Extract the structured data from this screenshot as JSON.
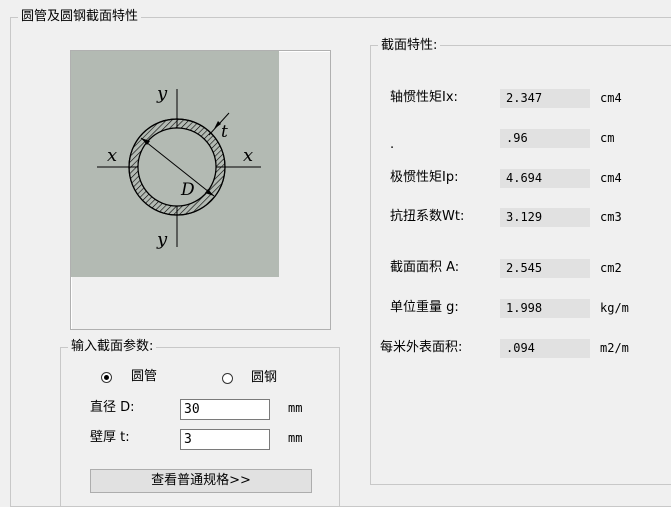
{
  "main_group": {
    "title": "圆管及圆钢截面特性"
  },
  "figure": {
    "labels": {
      "y_top": "y",
      "y_bottom": "y",
      "x_left": "x",
      "x_right": "x",
      "thickness": "t",
      "diameter": "D"
    },
    "colors": {
      "background": "#b3bab3",
      "stroke": "#000000"
    }
  },
  "properties": {
    "title": "截面特性:",
    "rows": [
      {
        "label": "轴惯性矩Ix:",
        "value": "2.347",
        "unit": "cm4"
      },
      {
        "label": ".",
        "value": ".96",
        "unit": "cm"
      },
      {
        "label": "极惯性矩Ip:",
        "value": "4.694",
        "unit": "cm4"
      },
      {
        "label": "抗扭系数Wt:",
        "value": "3.129",
        "unit": "cm3"
      },
      {
        "label": "截面面积 A:",
        "value": "2.545",
        "unit": "cm2"
      },
      {
        "label": "单位重量 g:",
        "value": "1.998",
        "unit": "kg/m"
      },
      {
        "label": "每米外表面积:",
        "value": ".094",
        "unit": "m2/m"
      }
    ]
  },
  "input_group": {
    "title": "输入截面参数:",
    "radio_tube": {
      "label": "圆管",
      "selected": true
    },
    "radio_bar": {
      "label": "圆钢",
      "selected": false
    },
    "diameter": {
      "label": "直径 D:",
      "value": "30",
      "unit": "mm"
    },
    "thickness": {
      "label": "壁厚 t:",
      "value": "3",
      "unit": "mm"
    },
    "spec_button": "查看普通规格>>"
  }
}
